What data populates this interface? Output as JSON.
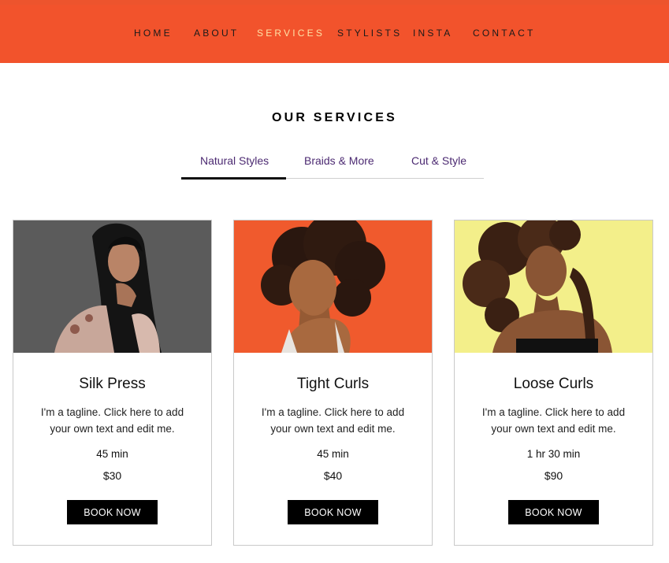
{
  "nav": {
    "items": [
      {
        "label": "HOME"
      },
      {
        "label": "ABOUT"
      },
      {
        "label": "SERVICES",
        "active": true
      },
      {
        "label": "STYLISTS"
      },
      {
        "label": "INSTA"
      },
      {
        "label": "CONTACT"
      }
    ]
  },
  "colors": {
    "header_bg": "#f2532c",
    "nav_active": "#ffe2a6",
    "tab_text": "#4c2a72",
    "button_bg": "#000000"
  },
  "section": {
    "title": "OUR SERVICES",
    "tabs": [
      {
        "label": "Natural Styles",
        "active": true
      },
      {
        "label": "Braids & More"
      },
      {
        "label": "Cut & Style"
      }
    ]
  },
  "services": [
    {
      "name": "Silk Press",
      "tagline": "I'm a tagline. Click here to add your own text and edit me.",
      "duration": "45 min",
      "price": "$30",
      "button": "BOOK NOW",
      "photo": "model-long-straight-hair-photo"
    },
    {
      "name": "Tight Curls",
      "tagline": "I'm a tagline. Click here to add your own text and edit me.",
      "duration": "45 min",
      "price": "$40",
      "button": "BOOK NOW",
      "photo": "model-tight-curls-photo"
    },
    {
      "name": "Loose Curls",
      "tagline": "I'm a tagline. Click here to add your own text and edit me.",
      "duration": "1 hr 30 min",
      "price": "$90",
      "button": "BOOK NOW",
      "photo": "model-loose-curls-photo"
    }
  ]
}
